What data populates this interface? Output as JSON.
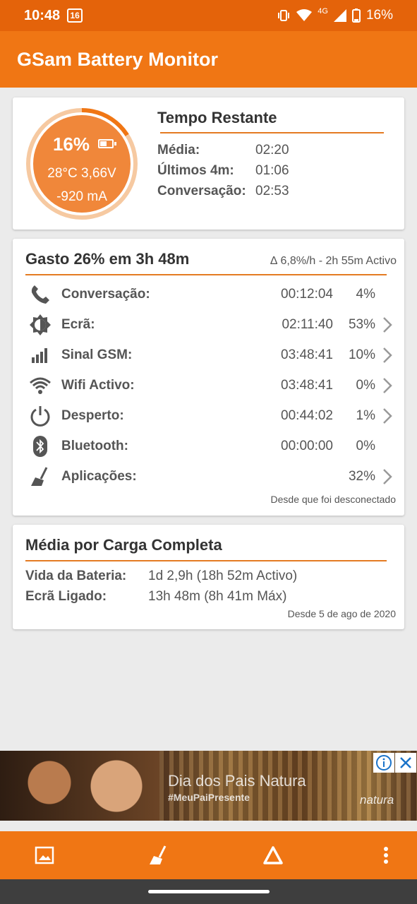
{
  "status_bar": {
    "time": "10:48",
    "notification_badge": "16",
    "network": "4G",
    "battery": "16%"
  },
  "app": {
    "title": "GSam Battery Monitor",
    "accent_color": "#f07614",
    "statusbar_color": "#e4630a"
  },
  "battery_gauge": {
    "percent": "16%",
    "level": 0.16,
    "temp_voltage": "28°C  3,66V",
    "current": "-920 mA"
  },
  "remaining": {
    "title": "Tempo Restante",
    "rows": [
      {
        "label": "Média:",
        "value": "02:20"
      },
      {
        "label": "Últimos 4m:",
        "value": "01:06"
      },
      {
        "label": "Conversação:",
        "value": "02:53"
      }
    ]
  },
  "usage": {
    "title": "Gasto 26% em 3h 48m",
    "subtitle": "∆ 6,8%/h - 2h 55m Activo",
    "rows": [
      {
        "icon": "phone-icon",
        "label": "Conversação:",
        "duration": "00:12:04",
        "percent": "4%",
        "chevron": false
      },
      {
        "icon": "brightness-icon",
        "label": "Ecrã:",
        "duration": "02:11:40",
        "percent": "53%",
        "chevron": true
      },
      {
        "icon": "signal-bars-icon",
        "label": "Sinal GSM:",
        "duration": "03:48:41",
        "percent": "10%",
        "chevron": true
      },
      {
        "icon": "wifi-icon",
        "label": "Wifi Activo:",
        "duration": "03:48:41",
        "percent": "0%",
        "chevron": true
      },
      {
        "icon": "power-icon",
        "label": "Desperto:",
        "duration": "00:44:02",
        "percent": "1%",
        "chevron": true
      },
      {
        "icon": "bluetooth-icon",
        "label": "Bluetooth:",
        "duration": "00:00:00",
        "percent": "0%",
        "chevron": false
      },
      {
        "icon": "broom-icon",
        "label": "Aplicações:",
        "duration": "",
        "percent": "32%",
        "chevron": true
      }
    ],
    "footer": "Desde que foi desconectado"
  },
  "full_charge": {
    "title": "Média por Carga Completa",
    "rows": [
      {
        "label": "Vida da Bateria:",
        "value": "1d 2,9h (18h 52m Activo)"
      },
      {
        "label": "Ecrã Ligado:",
        "value": "13h 48m (8h 41m Máx)"
      }
    ],
    "footer": "Desde 5 de ago de 2020"
  },
  "ad": {
    "headline": "Dia dos Pais Natura",
    "hashtag": "#MeuPaiPresente",
    "brand": "natura"
  },
  "bottom_bar": {
    "icons": [
      "image-icon",
      "broom-icon",
      "triangle-icon",
      "more-vert-icon"
    ]
  }
}
